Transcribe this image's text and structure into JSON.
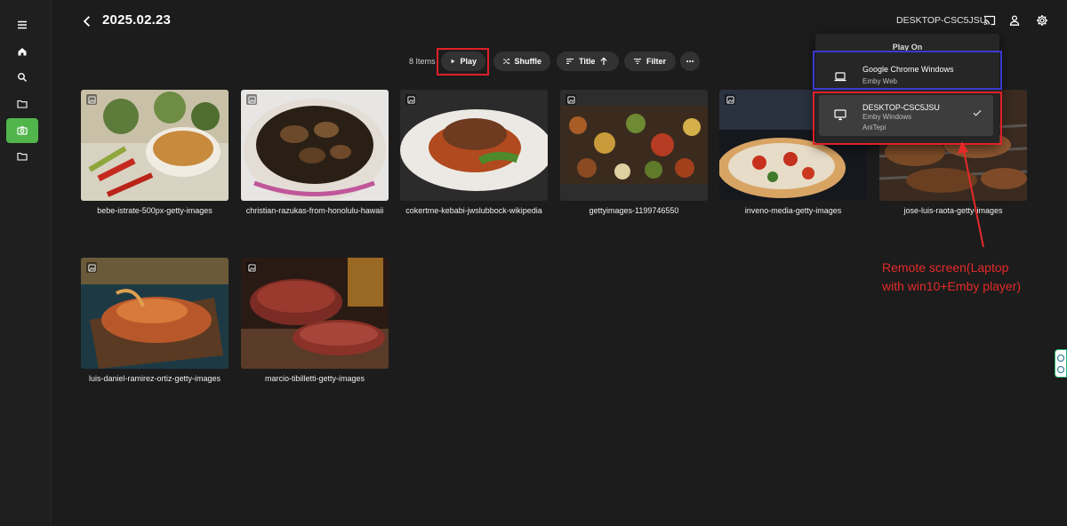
{
  "header": {
    "title": "2025.02.23",
    "server_name": "DESKTOP-CSC5JSU"
  },
  "toolbar": {
    "item_count": "8 Items",
    "play_label": "Play",
    "shuffle_label": "Shuffle",
    "sort_label": "Title",
    "filter_label": "Filter"
  },
  "items": [
    {
      "title": "bebe-istrate-500px-getty-images"
    },
    {
      "title": "christian-razukas-from-honolulu-hawaii"
    },
    {
      "title": "cokertme-kebabi-jwslubbock-wikipedia"
    },
    {
      "title": "gettyimages-1199746550"
    },
    {
      "title": "inveno-media-getty-images"
    },
    {
      "title": "jose-luis-raota-getty-images"
    },
    {
      "title": "luis-daniel-ramirez-ortiz-getty-images"
    },
    {
      "title": "marcio-tibilletti-getty-images"
    }
  ],
  "play_on": {
    "title": "Play On",
    "devices": [
      {
        "name": "Google Chrome Windows",
        "sub1": "Emby Web",
        "sub2": ""
      },
      {
        "name": "DESKTOP-CSC5JSU",
        "sub1": "Emby Windows",
        "sub2": "AniTepi"
      }
    ]
  },
  "annotation": {
    "line1": "Remote screen(Laptop",
    "line2": "with win10+Emby player)"
  },
  "colors": {
    "accent": "#52b54b",
    "highlight_red": "#e0202a",
    "highlight_blue": "#3a3ad0",
    "bg": "#1c1c1c"
  }
}
